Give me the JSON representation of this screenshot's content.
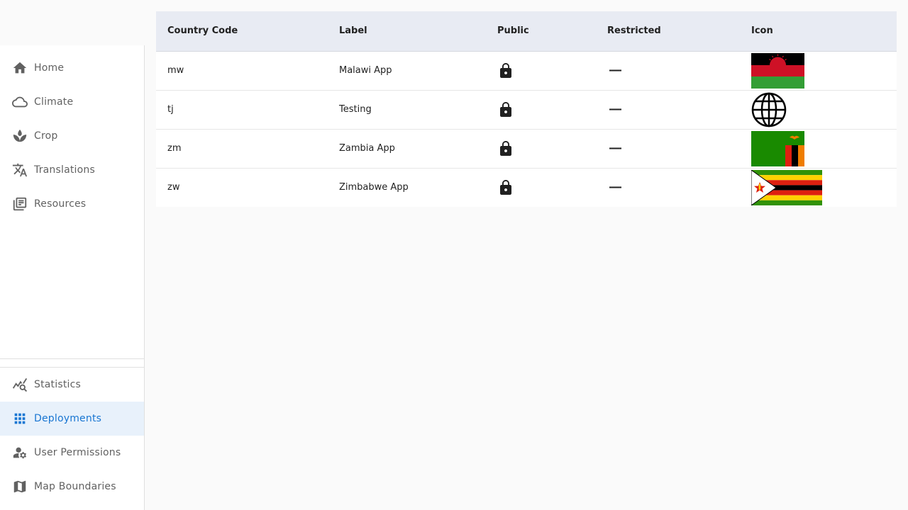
{
  "sidebar": {
    "items": [
      {
        "label": "Home",
        "icon": "home-icon"
      },
      {
        "label": "Climate",
        "icon": "cloud-icon"
      },
      {
        "label": "Crop",
        "icon": "sprout-icon"
      },
      {
        "label": "Translations",
        "icon": "translate-icon"
      },
      {
        "label": "Resources",
        "icon": "library-books-icon"
      }
    ],
    "bottom_items": [
      {
        "label": "Statistics",
        "icon": "query-stats-icon"
      },
      {
        "label": "Deployments",
        "icon": "apps-grid-icon",
        "active": true
      },
      {
        "label": "User Permissions",
        "icon": "manage-accounts-icon"
      },
      {
        "label": "Map Boundaries",
        "icon": "map-icon"
      }
    ],
    "active_color": "#1976d2"
  },
  "table": {
    "columns": [
      "Country Code",
      "Label",
      "Public",
      "Restricted",
      "Icon"
    ],
    "rows": [
      {
        "code": "mw",
        "label": "Malawi App",
        "public": "lock-icon",
        "restricted": "dash-icon",
        "icon": "malawi-flag"
      },
      {
        "code": "tj",
        "label": "Testing",
        "public": "lock-icon",
        "restricted": "dash-icon",
        "icon": "globe-icon"
      },
      {
        "code": "zm",
        "label": "Zambia App",
        "public": "lock-icon",
        "restricted": "dash-icon",
        "icon": "zambia-flag"
      },
      {
        "code": "zw",
        "label": "Zimbabwe App",
        "public": "lock-icon",
        "restricted": "dash-icon",
        "icon": "zimbabwe-flag"
      }
    ]
  }
}
